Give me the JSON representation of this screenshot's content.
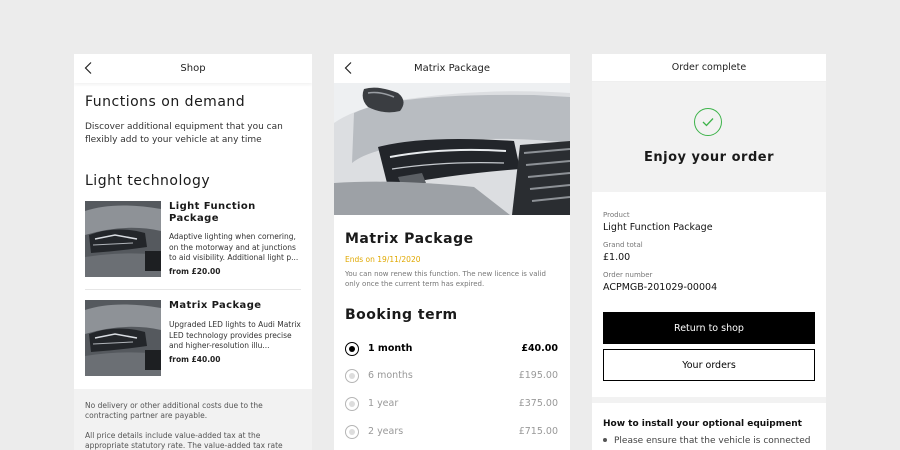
{
  "screen_shop": {
    "header_title": "Shop",
    "title": "Functions on demand",
    "intro": "Discover additional equipment that you can flexibly add to your vehicle at any time",
    "section_title": "Light technology",
    "cards": [
      {
        "name": "Light Function Package",
        "description": "Adaptive lighting when cornering, on the motorway and at junctions to aid visibility. Additional light p...",
        "price": "from £20.00"
      },
      {
        "name": "Matrix Package",
        "description": "Upgraded LED lights to Audi Matrix LED technology provides precise and higher-resolution illu...",
        "price": "from £40.00"
      }
    ],
    "footer_notes": [
      "No delivery or other additional costs due to the contracting partner are payable.",
      "All price details include value-added tax at the appropriate statutory rate. The value-added tax rate may"
    ]
  },
  "screen_package": {
    "header_title": "Matrix Package",
    "title": "Matrix Package",
    "ends": "Ends on 19/11/2020",
    "note": "You can now renew this function. The new licence is valid only once the current term has expired.",
    "booking_title": "Booking term",
    "terms": [
      {
        "label": "1 month",
        "price": "£40.00",
        "selected": true
      },
      {
        "label": "6 months",
        "price": "£195.00",
        "selected": false
      },
      {
        "label": "1 year",
        "price": "£375.00",
        "selected": false
      },
      {
        "label": "2 years",
        "price": "£715.00",
        "selected": false
      }
    ]
  },
  "screen_complete": {
    "header_title": "Order complete",
    "title": "Enjoy your order",
    "product_label": "Product",
    "product_value": "Light Function Package",
    "total_label": "Grand total",
    "total_value": "£1.00",
    "order_label": "Order number",
    "order_value": "ACPMGB-201029-00004",
    "return_button": "Return to shop",
    "orders_button": "Your orders",
    "install_heading": "How to install your optional equipment",
    "install_bullet": "Please ensure that the vehicle is connected"
  },
  "colors": {
    "background": "#ececec",
    "accent_yellow": "#e0a800",
    "success_green": "#3db34a",
    "primary_button": "#000000"
  },
  "icons": {
    "back": "chevron-left-icon",
    "success": "check-circle-icon"
  }
}
